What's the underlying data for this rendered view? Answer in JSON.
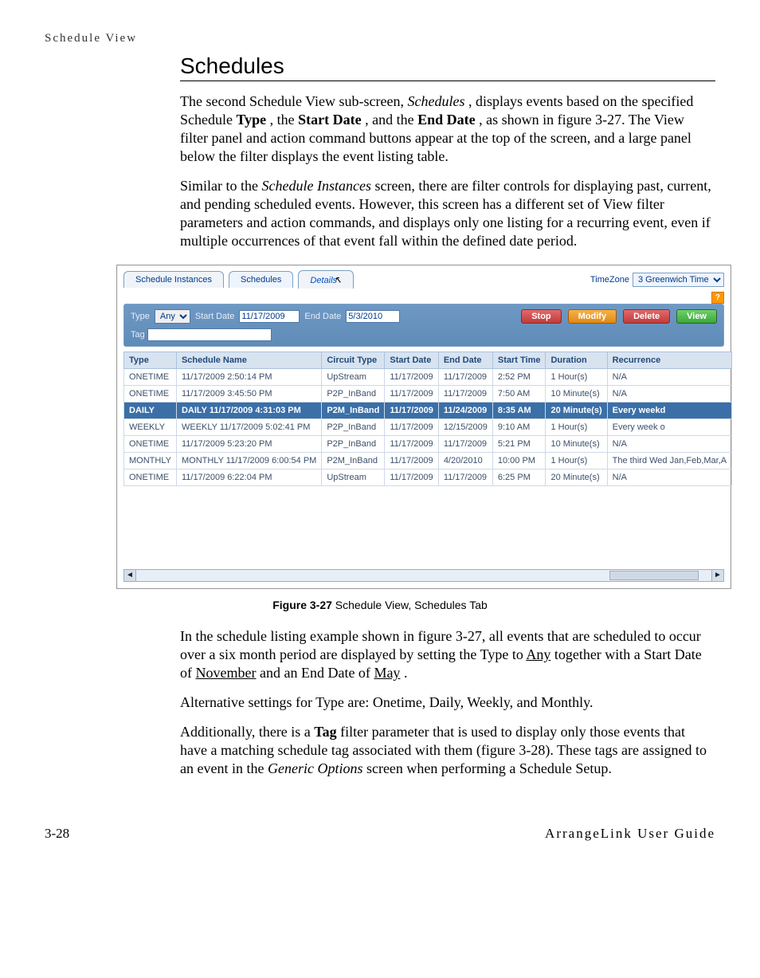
{
  "running_header": "Schedule View",
  "section_title": "Schedules",
  "p1": {
    "t1": "The second Schedule View sub-screen, ",
    "i1": "Schedules",
    "t2": ", displays events based on the specified Schedule ",
    "b1": "Type",
    "t3": ", the ",
    "b2": "Start Date",
    "t4": ", and the ",
    "b3": "End Date",
    "t5": ", as shown in figure 3-27. The View filter panel and action command buttons appear at the top of the screen, and a large panel below the filter displays the event listing table."
  },
  "p2": {
    "t1": "Similar to the ",
    "i1": "Schedule Instances",
    "t2": " screen, there are filter controls for displaying past, current, and pending scheduled events. However, this screen has a different set of View filter parameters and action commands, and displays only one listing for a recurring event, even if multiple occurrences of that event fall within the defined date period."
  },
  "mock": {
    "tabs": {
      "si": "Schedule Instances",
      "sched": "Schedules",
      "details": "Details"
    },
    "tz_label": "TimeZone",
    "tz_value": "3 Greenwich Time",
    "help": "?",
    "filter": {
      "type_lbl": "Type",
      "type_val": "Any",
      "start_lbl": "Start Date",
      "start_val": "11/17/2009",
      "end_lbl": "End Date",
      "end_val": "5/3/2010",
      "tag_lbl": "Tag",
      "btn_stop": "Stop",
      "btn_modify": "Modify",
      "btn_delete": "Delete",
      "btn_view": "View"
    },
    "headers": [
      "Type",
      "Schedule Name",
      "Circuit Type",
      "Start Date",
      "End Date",
      "Start Time",
      "Duration",
      "Recurrence"
    ],
    "rows": [
      {
        "c": [
          "ONETIME",
          "11/17/2009 2:50:14 PM",
          "UpStream",
          "11/17/2009",
          "11/17/2009",
          "2:52 PM",
          "1 Hour(s)",
          "N/A"
        ]
      },
      {
        "c": [
          "ONETIME",
          "11/17/2009 3:45:50 PM",
          "P2P_InBand",
          "11/17/2009",
          "11/17/2009",
          "7:50 AM",
          "10 Minute(s)",
          "N/A"
        ]
      },
      {
        "sel": true,
        "c": [
          "DAILY",
          "DAILY 11/17/2009 4:31:03 PM",
          "P2M_InBand",
          "11/17/2009",
          "11/24/2009",
          "8:35 AM",
          "20 Minute(s)",
          "Every weekd"
        ]
      },
      {
        "c": [
          "WEEKLY",
          "WEEKLY 11/17/2009 5:02:41 PM",
          "P2P_InBand",
          "11/17/2009",
          "12/15/2009",
          "9:10 AM",
          "1 Hour(s)",
          "Every week o"
        ]
      },
      {
        "c": [
          "ONETIME",
          "11/17/2009 5:23:20 PM",
          "P2P_InBand",
          "11/17/2009",
          "11/17/2009",
          "5:21 PM",
          "10 Minute(s)",
          "N/A"
        ]
      },
      {
        "c": [
          "MONTHLY",
          "MONTHLY 11/17/2009 6:00:54 PM",
          "P2M_InBand",
          "11/17/2009",
          "4/20/2010",
          "10:00 PM",
          "1 Hour(s)",
          "The third Wed Jan,Feb,Mar,A"
        ]
      },
      {
        "c": [
          "ONETIME",
          "11/17/2009 6:22:04 PM",
          "UpStream",
          "11/17/2009",
          "11/17/2009",
          "6:25 PM",
          "20 Minute(s)",
          "N/A"
        ]
      }
    ]
  },
  "fig_caption_bold": "Figure 3-27",
  "fig_caption_rest": "   Schedule View, Schedules Tab",
  "p3": {
    "t1": "In the schedule listing example shown in figure 3-27, all events that are scheduled to occur over a six month period are displayed by setting the Type to ",
    "u1": "Any",
    "t2": " together with a Start Date of ",
    "u2": "November",
    "t3": " and an End Date of ",
    "u3": "May",
    "t4": "."
  },
  "p4": "Alternative settings for Type are: Onetime, Daily, Weekly, and Monthly.",
  "p5": {
    "t1": "Additionally, there is a ",
    "b1": "Tag",
    "t2": " filter parameter that is used to display only those events that have a matching schedule tag associated with them (figure 3-28). These tags are assigned to an event in the ",
    "i1": "Generic Options",
    "t3": " screen when performing a Schedule Setup."
  },
  "footer_left": "3-28",
  "footer_right": "ArrangeLink User Guide"
}
